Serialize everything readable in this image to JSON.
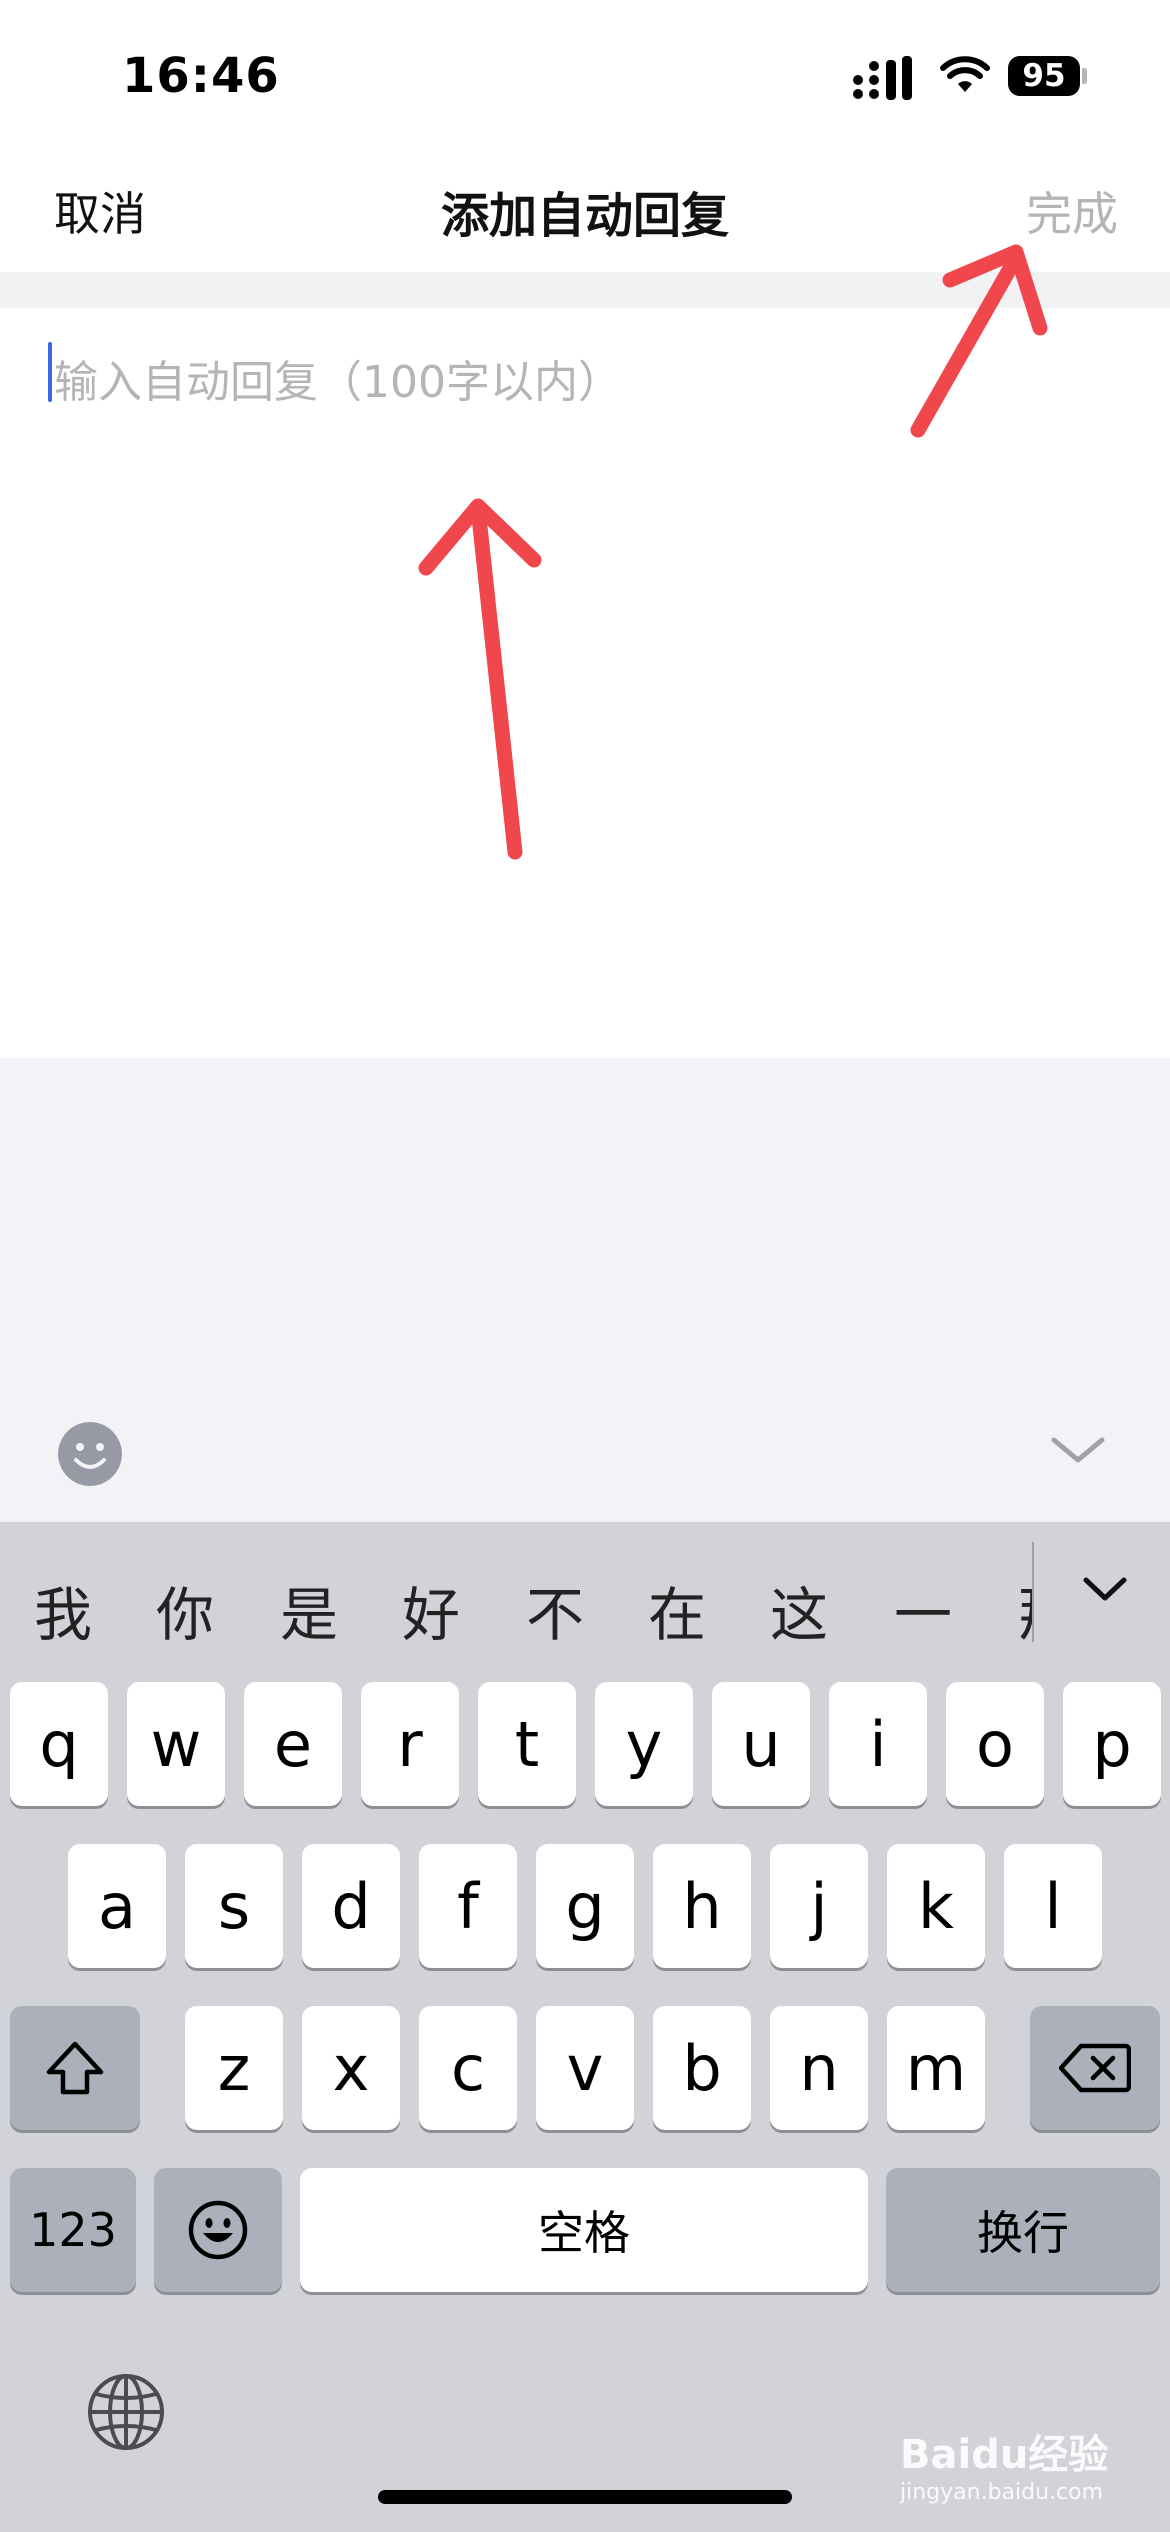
{
  "status_bar": {
    "time": "16:46",
    "battery": "95"
  },
  "nav": {
    "cancel_label": "取消",
    "title": "添加自动回复",
    "done_label": "完成"
  },
  "editor": {
    "placeholder": "输入自动回复（100字以内）"
  },
  "keyboard": {
    "candidates": [
      "我",
      "你",
      "是",
      "好",
      "不",
      "在",
      "这",
      "一",
      "那"
    ],
    "row1": [
      "q",
      "w",
      "e",
      "r",
      "t",
      "y",
      "u",
      "i",
      "o",
      "p"
    ],
    "row2": [
      "a",
      "s",
      "d",
      "f",
      "g",
      "h",
      "j",
      "k",
      "l"
    ],
    "row3": [
      "z",
      "x",
      "c",
      "v",
      "b",
      "n",
      "m"
    ],
    "numbers_label": "123",
    "space_label": "空格",
    "return_label": "换行"
  },
  "icons": {
    "emoji_toolbar": "smiley-icon",
    "collapse": "chevron-down-icon",
    "shift": "shift-icon",
    "delete": "backspace-icon",
    "globe": "globe-icon"
  },
  "watermark": {
    "brand": "Baidu经验",
    "url": "jingyan.baidu.com"
  },
  "colors": {
    "cursor": "#3b68e8",
    "keyboard_bg": "#d1d3d9",
    "key_bg": "#ffffff",
    "special_key_bg": "#abb0ba"
  }
}
